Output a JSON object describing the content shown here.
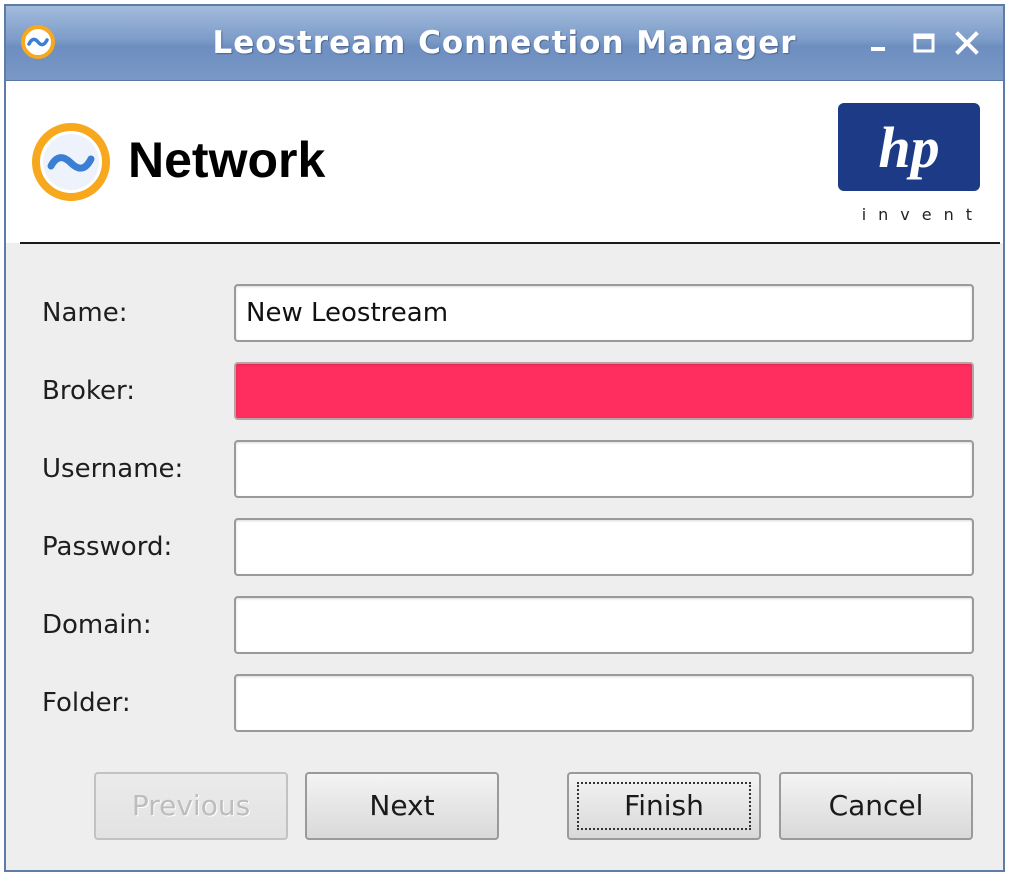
{
  "window": {
    "title": "Leostream Connection Manager"
  },
  "header": {
    "page_title": "Network",
    "logo_text": "hp",
    "logo_tagline": "invent"
  },
  "form": {
    "fields": [
      {
        "label": "Name:",
        "value": "New Leostream",
        "placeholder": "",
        "state": "normal"
      },
      {
        "label": "Broker:",
        "value": "",
        "placeholder": "",
        "state": "error"
      },
      {
        "label": "Username:",
        "value": "",
        "placeholder": "",
        "state": "normal"
      },
      {
        "label": "Password:",
        "value": "",
        "placeholder": "",
        "state": "normal"
      },
      {
        "label": "Domain:",
        "value": "",
        "placeholder": "",
        "state": "normal"
      },
      {
        "label": "Folder:",
        "value": "",
        "placeholder": "",
        "state": "normal"
      }
    ]
  },
  "buttons": {
    "previous": {
      "label": "Previous",
      "enabled": false
    },
    "next": {
      "label": "Next",
      "enabled": true
    },
    "finish": {
      "label": "Finish",
      "enabled": true,
      "focused": true
    },
    "cancel": {
      "label": "Cancel",
      "enabled": true
    }
  },
  "icons": {
    "app_icon": "leostream-wave-icon",
    "minimize": "minimize-icon",
    "maximize": "maximize-icon",
    "close": "close-icon"
  },
  "colors": {
    "titlebar": "#7d9cc8",
    "error_field": "#ff2e5e",
    "hp_blue": "#1d3a86",
    "leostream_orange": "#f7a81d",
    "leostream_blue": "#3a7fd3"
  }
}
